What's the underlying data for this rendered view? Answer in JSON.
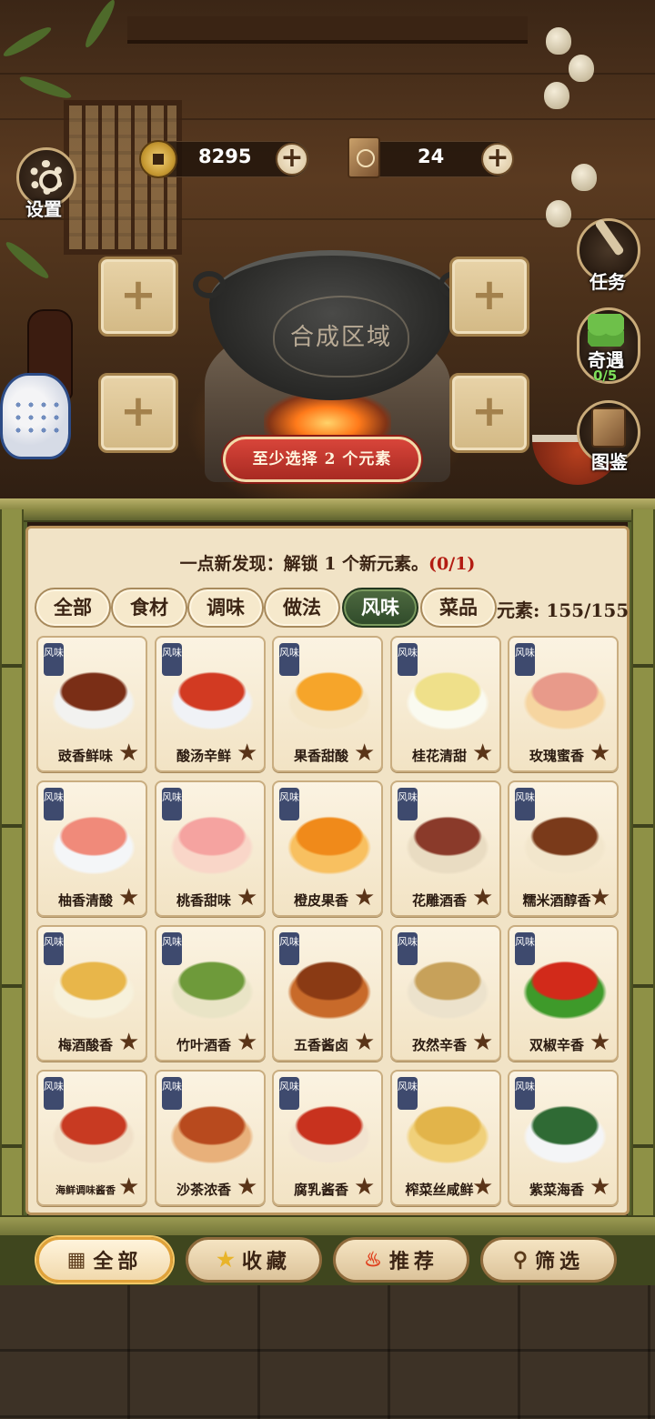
{
  "currencies": {
    "coins": "8295",
    "books": "24"
  },
  "side_buttons": {
    "settings": "设置",
    "tasks": "任务",
    "encounter": "奇遇",
    "encounter_progress": "0/5",
    "atlas": "图鉴"
  },
  "synthesis": {
    "area_label": "合成区域",
    "warning": "至少选择 2 个元素"
  },
  "discovery": {
    "text": "一点新发现：解锁 1 个新元素。",
    "progress": "(0/1)"
  },
  "tabs": [
    {
      "label": "全部",
      "active": false
    },
    {
      "label": "食材",
      "active": false
    },
    {
      "label": "调味",
      "active": false
    },
    {
      "label": "做法",
      "active": false
    },
    {
      "label": "风味",
      "active": true
    },
    {
      "label": "菜品",
      "active": false
    }
  ],
  "elements_count": "元素: 155/155",
  "card_badge": "风味",
  "cards": [
    {
      "name": "豉香鲜味",
      "icon": "black-bean-stew-bowl"
    },
    {
      "name": "酸汤辛鲜",
      "icon": "sour-soup-bowl"
    },
    {
      "name": "果香甜酸",
      "icon": "fruit-mango-plate"
    },
    {
      "name": "桂花清甜",
      "icon": "osmanthus-drink"
    },
    {
      "name": "玫瑰蜜香",
      "icon": "rose-honey-jar"
    },
    {
      "name": "柚香清酸",
      "icon": "pomelo-bowl"
    },
    {
      "name": "桃香甜味",
      "icon": "peach"
    },
    {
      "name": "橙皮果香",
      "icon": "orange-peel"
    },
    {
      "name": "花雕酒香",
      "icon": "huadiao-wine-jar"
    },
    {
      "name": "糯米酒醇香",
      "icon": "rice-wine-jar"
    },
    {
      "name": "梅酒酸香",
      "icon": "plum-wine-bottle"
    },
    {
      "name": "竹叶酒香",
      "icon": "bamboo-leaf-wine"
    },
    {
      "name": "五香酱卤",
      "icon": "braised-meat"
    },
    {
      "name": "孜然辛香",
      "icon": "cumin-sack"
    },
    {
      "name": "双椒辛香",
      "icon": "chili-peppers"
    },
    {
      "name": "海鲜调味酱香",
      "icon": "seafood-sauce-jar"
    },
    {
      "name": "沙茶浓香",
      "icon": "satay-sauce-jar"
    },
    {
      "name": "腐乳酱香",
      "icon": "fermented-tofu-jar"
    },
    {
      "name": "榨菜丝咸鲜",
      "icon": "pickled-mustard-strips"
    },
    {
      "name": "紫菜海香",
      "icon": "seaweed-soup-bowl"
    }
  ],
  "bottom_nav": [
    {
      "label": "全部",
      "icon": "grid-icon",
      "active": true
    },
    {
      "label": "收藏",
      "icon": "star-icon",
      "active": false
    },
    {
      "label": "推荐",
      "icon": "fire-icon",
      "active": false
    },
    {
      "label": "筛选",
      "icon": "filter-icon",
      "active": false
    }
  ],
  "colors": {
    "accent_green": "#2f4a2a",
    "warning_red": "#b31c12",
    "parchment": "#f1e3c6",
    "badge_blue": "#3e4a6e"
  }
}
